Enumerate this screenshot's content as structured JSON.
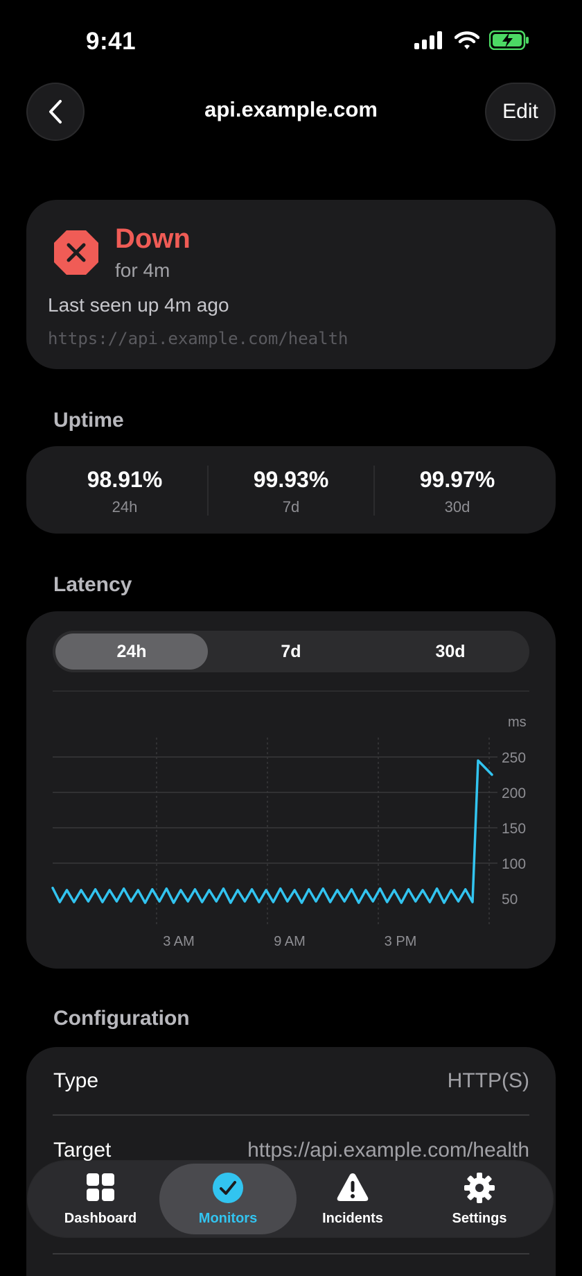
{
  "status_bar": {
    "time": "9:41"
  },
  "nav": {
    "title": "api.example.com",
    "edit_label": "Edit"
  },
  "status": {
    "state": "Down",
    "duration": "for 4m",
    "last_seen": "Last seen up 4m ago",
    "url": "https://api.example.com/health"
  },
  "uptime": {
    "title": "Uptime",
    "items": [
      {
        "value": "98.91%",
        "label": "24h"
      },
      {
        "value": "99.93%",
        "label": "7d"
      },
      {
        "value": "99.97%",
        "label": "30d"
      }
    ]
  },
  "latency": {
    "title": "Latency",
    "segments": [
      "24h",
      "7d",
      "30d"
    ],
    "selected_segment": "24h"
  },
  "chart_data": {
    "type": "line",
    "ylabel": "ms",
    "ylim": [
      0,
      250
    ],
    "yticks": [
      "250",
      "200",
      "150",
      "100",
      "50"
    ],
    "xticks": [
      "3 AM",
      "9 AM",
      "3 PM"
    ],
    "series": [
      {
        "color": "#32c4f0",
        "values": [
          65,
          45,
          62,
          45,
          62,
          46,
          63,
          45,
          62,
          46,
          64,
          46,
          62,
          44,
          63,
          46,
          64,
          44,
          62,
          46,
          63,
          45,
          62,
          46,
          64,
          44,
          62,
          46,
          63,
          45,
          62,
          45,
          64,
          46,
          62,
          44,
          63,
          46,
          64,
          45,
          62,
          46,
          63,
          44,
          62,
          46,
          64,
          45,
          62,
          44,
          63,
          46,
          62,
          45,
          64,
          44,
          62,
          46,
          63,
          45,
          245,
          225
        ]
      }
    ]
  },
  "configuration": {
    "title": "Configuration",
    "rows": [
      {
        "key": "Type",
        "value": "HTTP(S)"
      },
      {
        "key": "Target",
        "value": "https://api.example.com/health"
      }
    ]
  },
  "tabbar": {
    "tabs": [
      {
        "label": "Dashboard"
      },
      {
        "label": "Monitors"
      },
      {
        "label": "Incidents"
      },
      {
        "label": "Settings"
      }
    ],
    "selected": "Monitors"
  },
  "colors": {
    "accent": "#32c4f0",
    "danger": "#f05c56"
  }
}
